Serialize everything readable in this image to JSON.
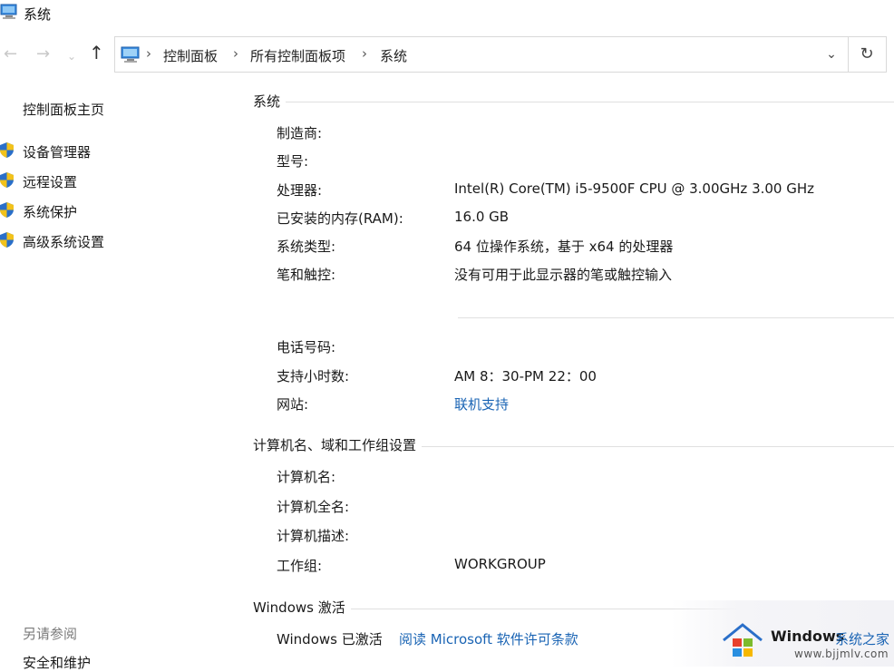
{
  "window": {
    "title": "系统"
  },
  "nav": {
    "back_icon": "arrow-left-icon",
    "forward_icon": "arrow-right-icon",
    "recent_icon": "chevron-down-icon",
    "up_icon": "arrow-up-icon"
  },
  "address": {
    "crumbs": [
      "控制面板",
      "所有控制面板项",
      "系统"
    ],
    "separator": "›",
    "dropdown_icon": "chevron-down-icon",
    "refresh_icon": "refresh-icon"
  },
  "sidebar": {
    "home": "控制面板主页",
    "items": [
      {
        "label": "设备管理器",
        "icon": "shield-icon"
      },
      {
        "label": "远程设置",
        "icon": "shield-icon"
      },
      {
        "label": "系统保护",
        "icon": "shield-icon"
      },
      {
        "label": "高级系统设置",
        "icon": "shield-icon"
      }
    ],
    "see_also": "另请参阅",
    "security": "安全和维护"
  },
  "system": {
    "heading": "系统",
    "rows": [
      {
        "label": "制造商:",
        "value": ""
      },
      {
        "label": "型号:",
        "value": ""
      },
      {
        "label": "处理器:",
        "value": "Intel(R) Core(TM) i5-9500F CPU @ 3.00GHz   3.00 GHz"
      },
      {
        "label": "已安装的内存(RAM):",
        "value": "16.0 GB"
      },
      {
        "label": "系统类型:",
        "value": "64 位操作系统，基于 x64 的处理器"
      },
      {
        "label": "笔和触控:",
        "value": "没有可用于此显示器的笔或触控输入"
      }
    ]
  },
  "support": {
    "rows": [
      {
        "label": "电话号码:",
        "value": ""
      },
      {
        "label": "支持小时数:",
        "value": "AM 8：30-PM 22：00"
      },
      {
        "label": "网站:",
        "value": "联机支持"
      }
    ]
  },
  "computer": {
    "heading": "计算机名、域和工作组设置",
    "rows": [
      {
        "label": "计算机名:",
        "value": ""
      },
      {
        "label": "计算机全名:",
        "value": ""
      },
      {
        "label": "计算机描述:",
        "value": ""
      },
      {
        "label": "工作组:",
        "value": "WORKGROUP"
      }
    ]
  },
  "activation": {
    "heading": "Windows 激活",
    "status": "Windows 已激活",
    "license_link": "阅读 Microsoft 软件许可条款"
  },
  "watermark": {
    "brand": "Windows",
    "brand_suffix": "系统之家",
    "url": "www.bjjmlv.com"
  },
  "colors": {
    "link": "#1a64b4",
    "shield_blue": "#2a6fc9",
    "shield_yellow": "#f2c21b"
  }
}
